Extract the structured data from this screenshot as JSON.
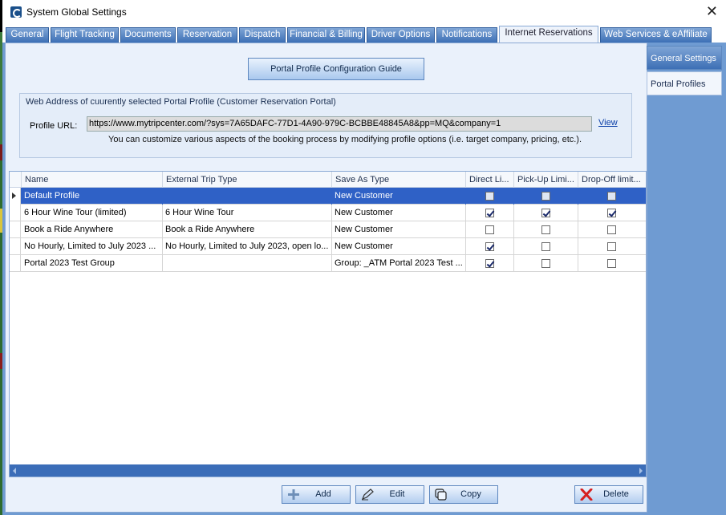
{
  "window": {
    "title": "System Global Settings",
    "close_glyph": "✕"
  },
  "tabs": [
    {
      "label": "General"
    },
    {
      "label": "Flight Tracking"
    },
    {
      "label": "Documents"
    },
    {
      "label": "Reservation"
    },
    {
      "label": "Dispatch"
    },
    {
      "label": "Financial & Billing"
    },
    {
      "label": "Driver Options"
    },
    {
      "label": "Notifications"
    },
    {
      "label": "Internet Reservations",
      "active": true
    },
    {
      "label": "Web Services & eAffiliate"
    }
  ],
  "side_nav": [
    {
      "label": "General Settings"
    },
    {
      "label": "Portal Profiles",
      "active": true
    }
  ],
  "guide_button": {
    "label": "Portal Profile Configuration Guide"
  },
  "web_address": {
    "group_title": "Web Address of cuurently selected Portal Profile (Customer Reservation Portal)",
    "url_label": "Profile URL:",
    "url_value": "https://www.mytripcenter.com/?sys=7A65DAFC-77D1-4A90-979C-BCBBE48845A8&pp=MQ&company=1",
    "view_link": "View",
    "hint": "You can customize various aspects of the booking process by modifying profile options (i.e. target company, pricing, etc.)."
  },
  "grid": {
    "columns": [
      {
        "label": "Name"
      },
      {
        "label": "External Trip Type"
      },
      {
        "label": "Save As Type"
      },
      {
        "label": "Direct Li..."
      },
      {
        "label": "Pick-Up Limi..."
      },
      {
        "label": "Drop-Off limit..."
      }
    ],
    "rows": [
      {
        "name": "Default Profile",
        "external_trip_type": "",
        "save_as_type": "New Customer",
        "direct": false,
        "pickup": false,
        "dropoff": false,
        "selected": true
      },
      {
        "name": "6 Hour Wine Tour (limited)",
        "external_trip_type": "6 Hour Wine Tour",
        "save_as_type": "New Customer",
        "direct": true,
        "pickup": true,
        "dropoff": true
      },
      {
        "name": "Book a Ride Anywhere",
        "external_trip_type": "Book a Ride Anywhere",
        "save_as_type": "New Customer",
        "direct": false,
        "pickup": false,
        "dropoff": false
      },
      {
        "name": "No Hourly, Limited to July 2023 ...",
        "external_trip_type": "No Hourly, Limited to July 2023, open lo...",
        "save_as_type": "New Customer",
        "direct": true,
        "pickup": false,
        "dropoff": false
      },
      {
        "name": "Portal 2023 Test Group",
        "external_trip_type": "",
        "save_as_type": "Group: _ATM Portal 2023 Test ...",
        "direct": true,
        "pickup": false,
        "dropoff": false
      }
    ]
  },
  "buttons": {
    "add": "Add",
    "edit": "Edit",
    "copy": "Copy",
    "delete": "Delete"
  },
  "colors": {
    "tab_blue": "#3d6fb5",
    "selected_row": "#2f61c6",
    "panel_bg": "#eaf1fb",
    "delete_icon": "#d62020"
  }
}
